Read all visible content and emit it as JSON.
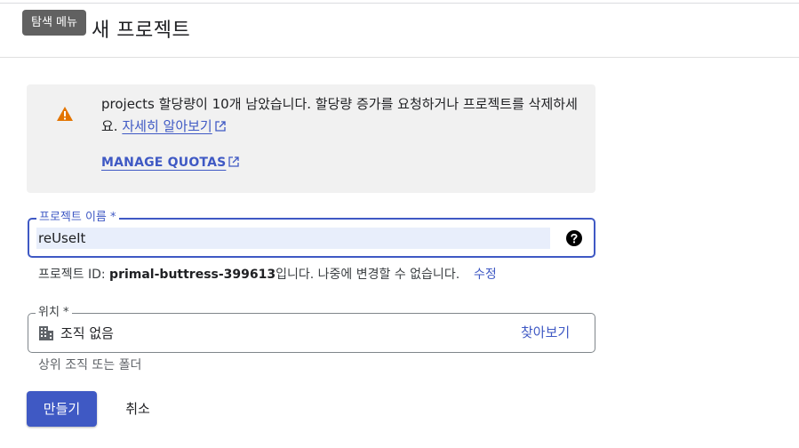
{
  "header": {
    "title": "새 프로젝트",
    "tooltip": "탐색 메뉴"
  },
  "banner": {
    "message": "projects 할당량이 10개 남았습니다. 할당량 증가를 요청하거나 프로젝트를 삭제하세요.",
    "learn_more": "자세히 알아보기",
    "manage_quotas": "MANAGE QUOTAS"
  },
  "project_name": {
    "label": "프로젝트 이름 *",
    "value": "reUseIt",
    "id_prefix": "프로젝트 ID: ",
    "id_value": "primal-buttress-399613",
    "id_suffix": "입니다. 나중에 변경할 수 없습니다.",
    "edit_label": "수정"
  },
  "location": {
    "label": "위치 *",
    "value": "조직 없음",
    "browse_label": "찾아보기",
    "hint": "상위 조직 또는 폴더"
  },
  "actions": {
    "create": "만들기",
    "cancel": "취소"
  },
  "colors": {
    "accent": "#3f59c4",
    "warning": "#e37400"
  }
}
